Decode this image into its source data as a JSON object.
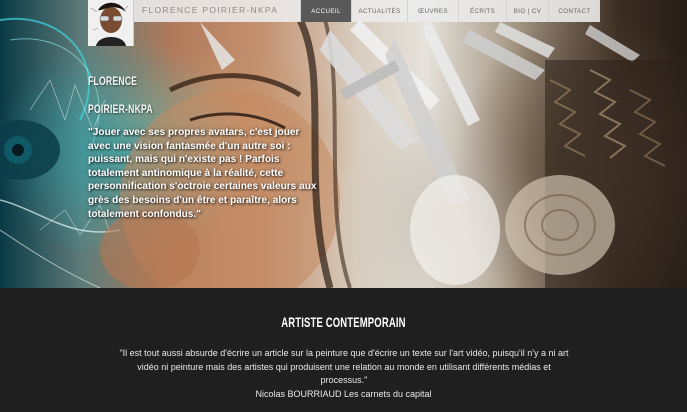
{
  "header": {
    "site_name": "FLORENCE POIRIER-NKPA",
    "nav": [
      {
        "label": "ACCUEIL",
        "active": true
      },
      {
        "label": "ACTUALITÉS",
        "active": false
      },
      {
        "label": "ŒUVRES",
        "active": false
      },
      {
        "label": "ÉCRITS",
        "active": false
      },
      {
        "label": "BIO | CV",
        "active": false
      },
      {
        "label": "CONTACT",
        "active": false
      }
    ]
  },
  "hero": {
    "first_name": "FLORENCE",
    "last_name": "POIRIER-NKPA",
    "quote": "\"Jouer avec ses propres avatars, c'est jouer avec une vision fantasmée d'un autre soi : puissant, mais qui n'existe pas ! Parfois totalement antinomique à la réalité, cette personnification s'octroie certaines valeurs aux grès des besoins d'un être et paraître, alors totalement confondus.\""
  },
  "section": {
    "title": "ARTISTE CONTEMPORAIN",
    "quote": "\"Il est tout aussi absurde d'écrire un article sur la peinture que d'écrire un texte sur l'art vidéo, puisqu'il n'y a ni art vidéo ni peinture mais des artistes qui produisent une relation au monde en utilisant différents médias et processus.\"",
    "author": "Nicolas BOURRIAUD Les carnets du capital"
  },
  "colors": {
    "nav_active_bg": "#595959",
    "header_bg": "#ebebeb",
    "bottom_bg": "#1f1f1f"
  }
}
